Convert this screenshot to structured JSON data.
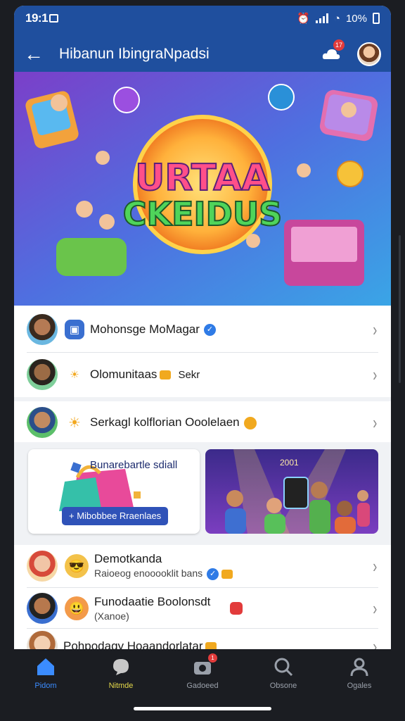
{
  "status": {
    "time": "19:1",
    "battery": "10%"
  },
  "header": {
    "title": "Hibanun IbingraNpadsi",
    "notif_badge": "17"
  },
  "banner": {
    "line1": "URTAA",
    "line2": "CKEIDUS"
  },
  "list_top": [
    {
      "title": "Mohonsge MoMagar",
      "verified": true
    },
    {
      "title": "Olomunitaas",
      "trailing": "Sekr"
    }
  ],
  "list_mid": [
    {
      "title": "Serkagl kolflorian Ooolelaen"
    }
  ],
  "promo": {
    "left_title": "Bunarebartle sdiall",
    "left_button": "+ Mibobbee Rraenlaes",
    "right_year": "2001"
  },
  "list_bottom": [
    {
      "title": "Demotkanda",
      "subtitle": "Raioeog enooooklit bans"
    },
    {
      "title": "Funodaatie Boolonsdt",
      "subtitle": "(Xanoe)"
    },
    {
      "title": "Pohpodagy Hoaandorlatar"
    }
  ],
  "nav": [
    {
      "label": "Pidom",
      "icon": "home-icon",
      "active": true
    },
    {
      "label": "Nitmde",
      "icon": "chat-bubble-icon",
      "active": false
    },
    {
      "label": "Gadoeed",
      "icon": "camera-icon",
      "badge": "1"
    },
    {
      "label": "Obsone",
      "icon": "search-icon"
    },
    {
      "label": "Ogales",
      "icon": "profile-icon"
    }
  ],
  "colors": {
    "primary": "#1f4f9e",
    "accent": "#2f7be6",
    "nav_active": "#3b8cff",
    "nav_highlight": "#e4d84a"
  }
}
